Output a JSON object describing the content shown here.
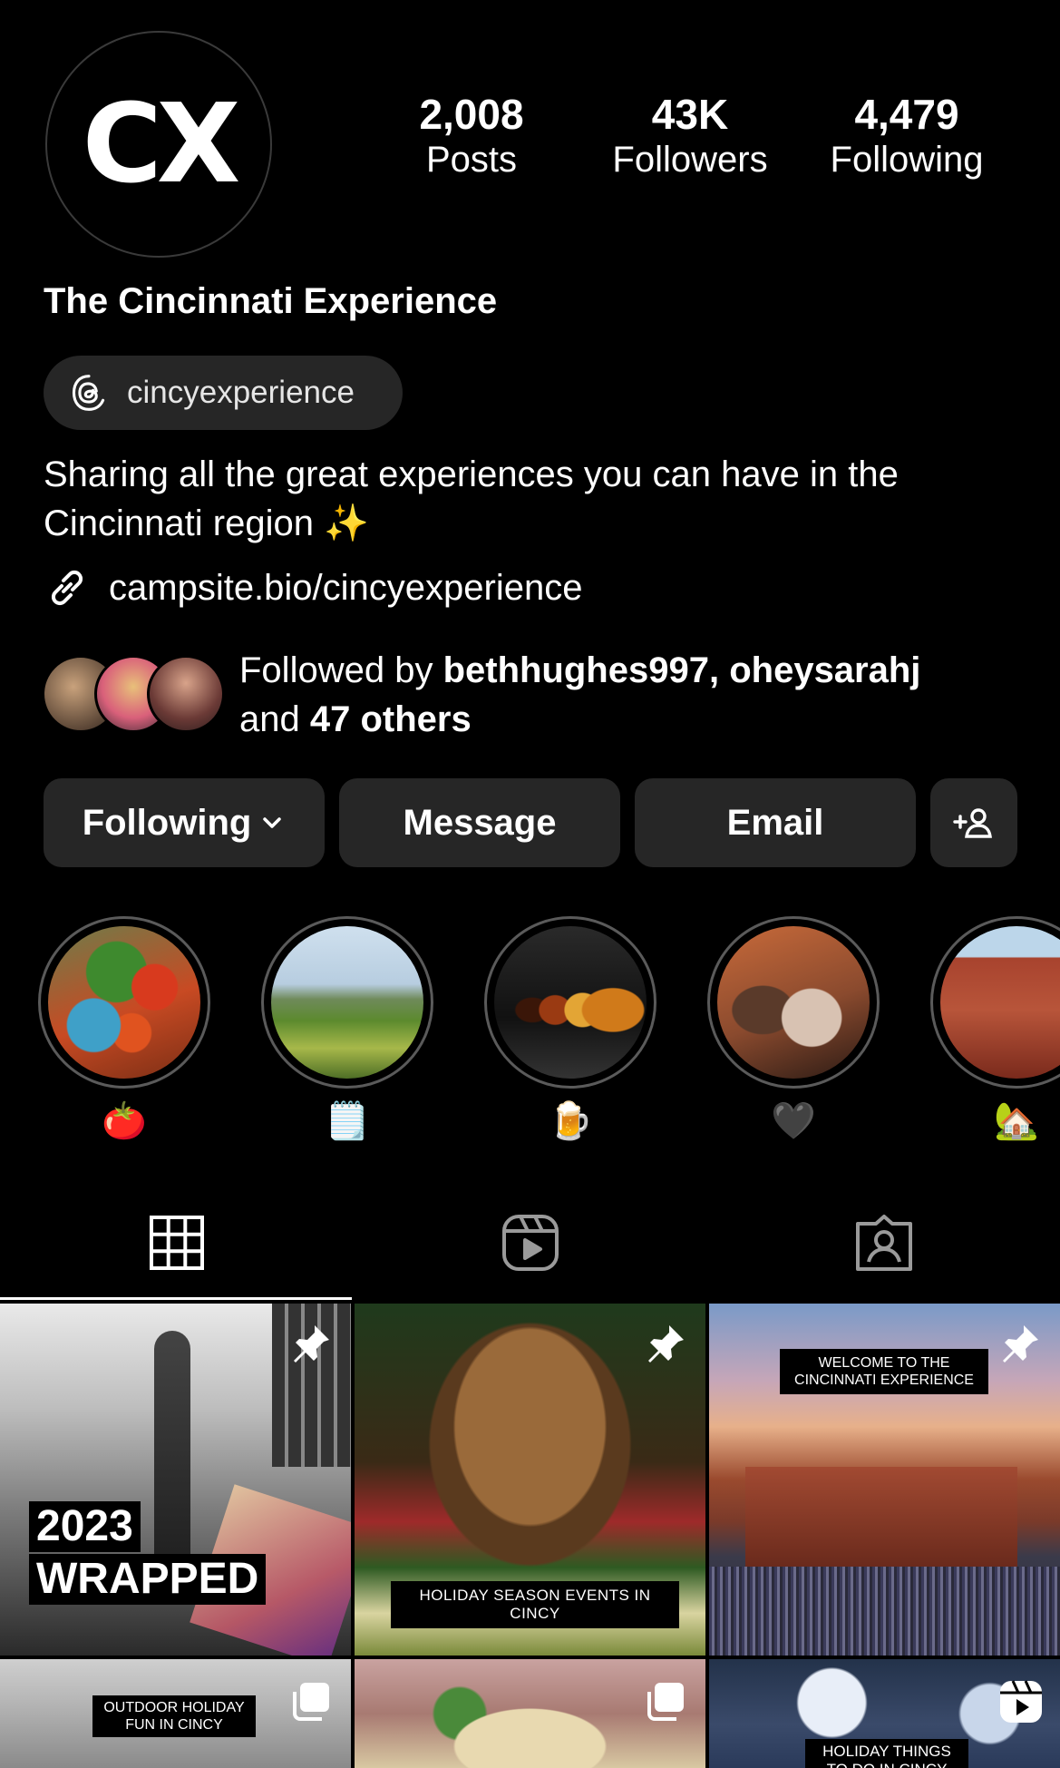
{
  "profile": {
    "avatar_text": "CX",
    "display_name": "The Cincinnati Experience",
    "threads_handle": "cincyexperience",
    "bio": "Sharing all the great experiences you can have in the Cincinnati region ✨",
    "link": "campsite.bio/cincyexperience"
  },
  "stats": {
    "posts_count": "2,008",
    "posts_label": "Posts",
    "followers_count": "43K",
    "followers_label": "Followers",
    "following_count": "4,479",
    "following_label": "Following"
  },
  "followed_by": {
    "prefix": "Followed by ",
    "user1": "bethhughes997",
    "sep": ", ",
    "user2": "oheysarahj",
    "and": "and ",
    "others": "47 others"
  },
  "actions": {
    "following_label": "Following",
    "message_label": "Message",
    "email_label": "Email"
  },
  "highlights": [
    {
      "emoji": "🍅"
    },
    {
      "emoji": "🗒️"
    },
    {
      "emoji": "🍺"
    },
    {
      "emoji": "🖤"
    },
    {
      "emoji": "🏡"
    }
  ],
  "posts": [
    {
      "line1": "2023",
      "line2": "WRAPPED"
    },
    {
      "caption": "HOLIDAY SEASON EVENTS IN CINCY"
    },
    {
      "line1": "WELCOME TO THE",
      "line2": "CINCINNATI EXPERIENCE"
    },
    {
      "line1": "OUTDOOR HOLIDAY",
      "line2": "FUN IN CINCY"
    },
    {
      "caption": ""
    },
    {
      "line1": "HOLIDAY THINGS",
      "line2": "TO DO IN CINCY"
    }
  ],
  "icons": {
    "threads": "threads-icon",
    "link": "link-icon",
    "chevron": "chevron-down-icon",
    "add_user": "add-user-icon",
    "grid": "grid-icon",
    "reels": "reels-icon",
    "tagged": "tagged-icon",
    "pin": "pin-icon",
    "carousel": "carousel-icon"
  }
}
